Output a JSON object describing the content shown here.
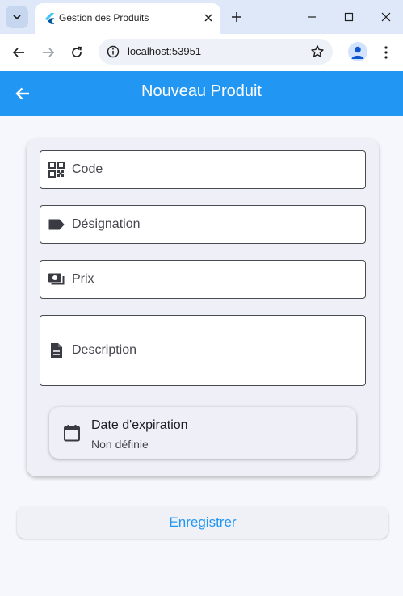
{
  "browser": {
    "tab_title": "Gestion des Produits",
    "url": "localhost:53951",
    "icons": {
      "tab_menu": "chevron-down-icon",
      "favicon": "flutter-icon",
      "tab_close": "close-icon",
      "new_tab": "plus-icon",
      "minimize": "minimize-icon",
      "maximize": "maximize-icon",
      "close_window": "close-icon",
      "back": "arrow-left-icon",
      "forward": "arrow-right-icon",
      "reload": "reload-icon",
      "site_info": "info-icon",
      "bookmark": "star-icon",
      "profile": "person-icon",
      "menu": "more-vert-icon"
    }
  },
  "app": {
    "title": "Nouveau Produit",
    "back_icon": "arrow-back-icon",
    "colors": {
      "primary": "#2196f3",
      "background": "#f6f7fc",
      "card": "#eff0f7"
    }
  },
  "form": {
    "fields": [
      {
        "label": "Code",
        "icon": "qr-code-icon"
      },
      {
        "label": "Désignation",
        "icon": "label-icon"
      },
      {
        "label": "Prix",
        "icon": "money-icon"
      },
      {
        "label": "Description",
        "icon": "description-icon"
      }
    ],
    "expiry": {
      "title": "Date d'expiration",
      "value": "Non définie",
      "icon": "calendar-icon"
    }
  },
  "actions": {
    "save_label": "Enregistrer"
  }
}
